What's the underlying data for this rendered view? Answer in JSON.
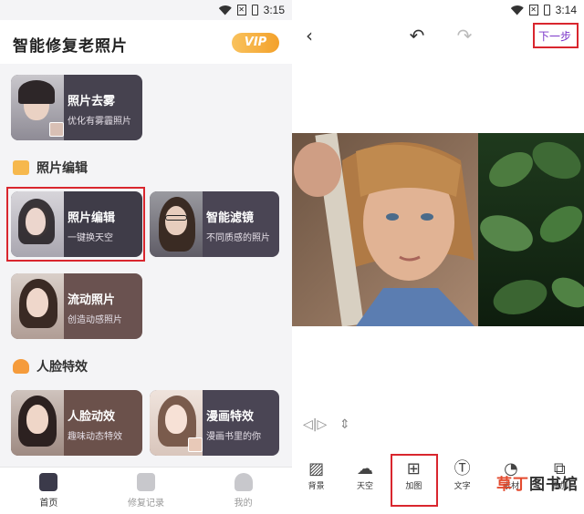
{
  "left": {
    "status_time": "3:15",
    "app_title": "智能修复老照片",
    "vip_label": "VIP",
    "cards": [
      {
        "title": "照片去雾",
        "subtitle": "优化有雾霾照片"
      },
      {
        "title": "照片编辑",
        "subtitle": "一键换天空"
      },
      {
        "title": "智能滤镜",
        "subtitle": "不同质感的照片"
      },
      {
        "title": "流动照片",
        "subtitle": "创造动感照片"
      },
      {
        "title": "人脸动效",
        "subtitle": "趣味动态特效"
      },
      {
        "title": "漫画特效",
        "subtitle": "漫画书里的你"
      }
    ],
    "sections": [
      "照片编辑",
      "人脸特效"
    ],
    "tabs": [
      "首页",
      "修复记录",
      "我的"
    ],
    "active_tab": "首页"
  },
  "right": {
    "status_time": "3:14",
    "next_label": "下一步",
    "tools": [
      {
        "label": "背景",
        "icon": "hatch-icon"
      },
      {
        "label": "天空",
        "icon": "cloud-icon"
      },
      {
        "label": "加图",
        "icon": "add-image-icon"
      },
      {
        "label": "文字",
        "icon": "text-icon"
      },
      {
        "label": "素材",
        "icon": "sticker-icon"
      },
      {
        "label": "叠加",
        "icon": "overlay-icon"
      }
    ],
    "watermark": "草丁图书馆"
  },
  "colors": {
    "accent_red": "#d9262e",
    "vip_gold": "#f3a12b",
    "next_purple": "#7b36c9"
  }
}
